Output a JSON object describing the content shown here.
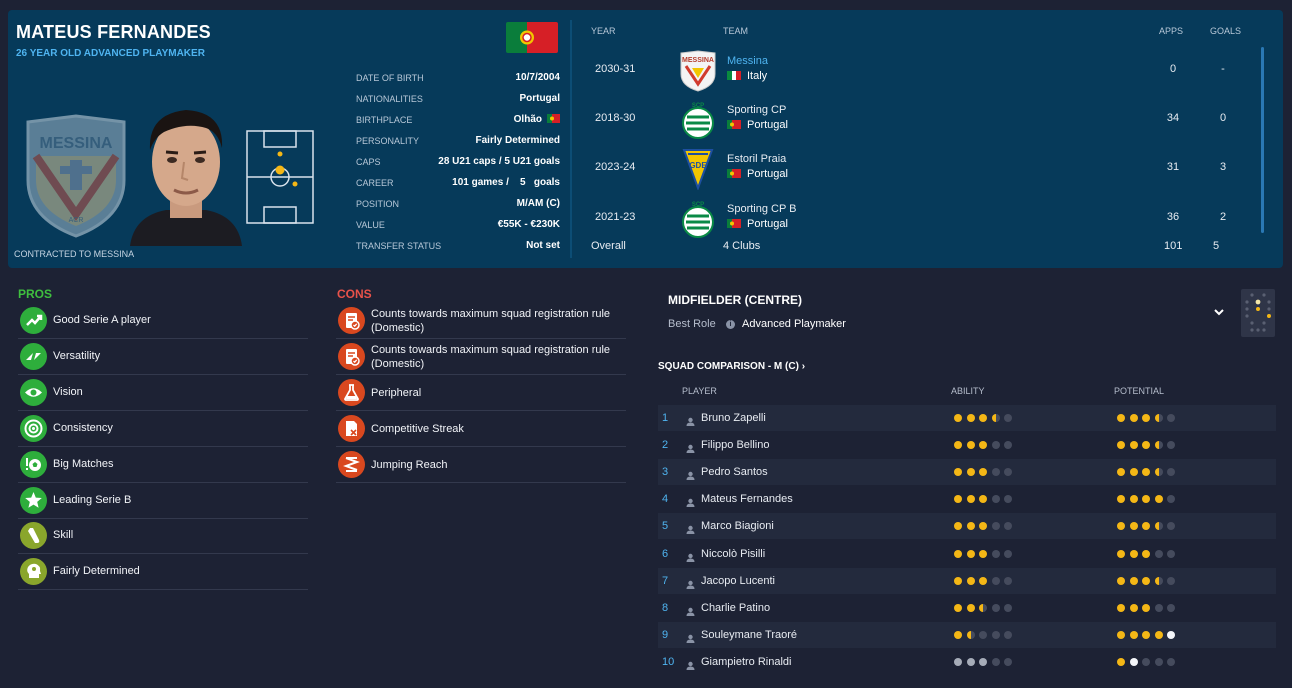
{
  "player": {
    "name": "MATEUS FERNANDES",
    "subtitle": "26 YEAR OLD  ADVANCED PLAYMAKER",
    "contracted": "CONTRACTED TO MESSINA",
    "club_badge_text": "MESSINA",
    "club_badge_sub": "ACR"
  },
  "info": [
    {
      "label": "DATE OF BIRTH",
      "value": "10/7/2004"
    },
    {
      "label": "NATIONALITIES",
      "value": "Portugal"
    },
    {
      "label": "BIRTHPLACE",
      "value": "Olhão"
    },
    {
      "label": "PERSONALITY",
      "value": "Fairly Determined"
    },
    {
      "label": "CAPS",
      "value": "28 U21 caps / 5 U21 goals"
    },
    {
      "label": "CAREER",
      "value": "101 games /    5   goals"
    },
    {
      "label": "POSITION",
      "value": "M/AM (C)"
    },
    {
      "label": "VALUE",
      "value": "€55K - €230K"
    },
    {
      "label": "TRANSFER STATUS",
      "value": "Not set"
    }
  ],
  "history": {
    "headers": {
      "year": "YEAR",
      "team": "TEAM",
      "apps": "APPS",
      "goals": "GOALS"
    },
    "rows": [
      {
        "year": "2030-31",
        "team": "Messina",
        "country": "Italy",
        "apps": "0",
        "goals": "-",
        "crest": "messina-crest",
        "flag": "italy-flag"
      },
      {
        "year": "2018-30",
        "team": "Sporting CP",
        "country": "Portugal",
        "apps": "34",
        "goals": "0",
        "crest": "sporting-crest",
        "flag": "portugal-flag"
      },
      {
        "year": "2023-24",
        "team": "Estoril Praia",
        "country": "Portugal",
        "apps": "31",
        "goals": "3",
        "crest": "estoril-crest",
        "flag": "portugal-flag"
      },
      {
        "year": "2021-23",
        "team": "Sporting CP B",
        "country": "Portugal",
        "apps": "36",
        "goals": "2",
        "crest": "sporting-crest",
        "flag": "portugal-flag"
      }
    ],
    "overall": {
      "label": "Overall",
      "clubs": "4 Clubs",
      "apps": "101",
      "goals": "5"
    }
  },
  "pros": {
    "title": "PROS",
    "items": [
      {
        "label": "Good Serie A player",
        "icon": "trend-up-icon"
      },
      {
        "label": "Versatility",
        "icon": "arrows-icon"
      },
      {
        "label": "Vision",
        "icon": "eye-icon"
      },
      {
        "label": "Consistency",
        "icon": "target-icon"
      },
      {
        "label": "Big Matches",
        "icon": "ball-icon"
      },
      {
        "label": "Leading Serie B",
        "icon": "star-icon"
      },
      {
        "label": "Skill",
        "icon": "boot-icon"
      },
      {
        "label": "Fairly Determined",
        "icon": "head-icon"
      }
    ]
  },
  "cons": {
    "title": "CONS",
    "items": [
      {
        "label": "Counts towards maximum squad registration rule (Domestic)",
        "icon": "registration-icon"
      },
      {
        "label": "Counts towards maximum squad registration rule (Domestic)",
        "icon": "registration-icon"
      },
      {
        "label": "Peripheral",
        "icon": "flask-icon"
      },
      {
        "label": "Competitive Streak",
        "icon": "document-icon"
      },
      {
        "label": "Jumping Reach",
        "icon": "spring-icon"
      }
    ]
  },
  "role": {
    "position": "MIDFIELDER (CENTRE)",
    "best_role_label": "Best Role",
    "best_role": "Advanced Playmaker"
  },
  "squad": {
    "title": "SQUAD COMPARISON - M (C)",
    "title_chevron": "›",
    "headers": {
      "player": "PLAYER",
      "ability": "ABILITY",
      "potential": "POTENTIAL"
    },
    "rows": [
      {
        "num": "1",
        "name": "Bruno Zapelli",
        "ability": 3.5,
        "potential": 3.5
      },
      {
        "num": "2",
        "name": "Filippo Bellino",
        "ability": 3,
        "potential": 3.5
      },
      {
        "num": "3",
        "name": "Pedro Santos",
        "ability": 3,
        "potential": 3.5
      },
      {
        "num": "4",
        "name": "Mateus Fernandes",
        "ability": 3,
        "potential": 4
      },
      {
        "num": "5",
        "name": "Marco Biagioni",
        "ability": 3,
        "potential": 3.5
      },
      {
        "num": "6",
        "name": "Niccolò Pisilli",
        "ability": 3,
        "potential": 3
      },
      {
        "num": "7",
        "name": "Jacopo Lucenti",
        "ability": 3,
        "potential": 3.5
      },
      {
        "num": "8",
        "name": "Charlie Patino",
        "ability": 2.5,
        "potential": 3
      },
      {
        "num": "9",
        "name": "Souleymane Traoré",
        "ability": 1.5,
        "potential": 5,
        "potential_color": "white-last"
      },
      {
        "num": "10",
        "name": "Giampietro Rinaldi",
        "ability": 3,
        "ability_color": "grey",
        "potential": 2,
        "potential_color": "white-last"
      }
    ]
  },
  "colors": {
    "header_bg": "#063a5a",
    "accent_blue": "#4fb4f0",
    "star_gold": "#f4b716",
    "pros_green": "#3fbf3f",
    "cons_red": "#e8524a"
  }
}
